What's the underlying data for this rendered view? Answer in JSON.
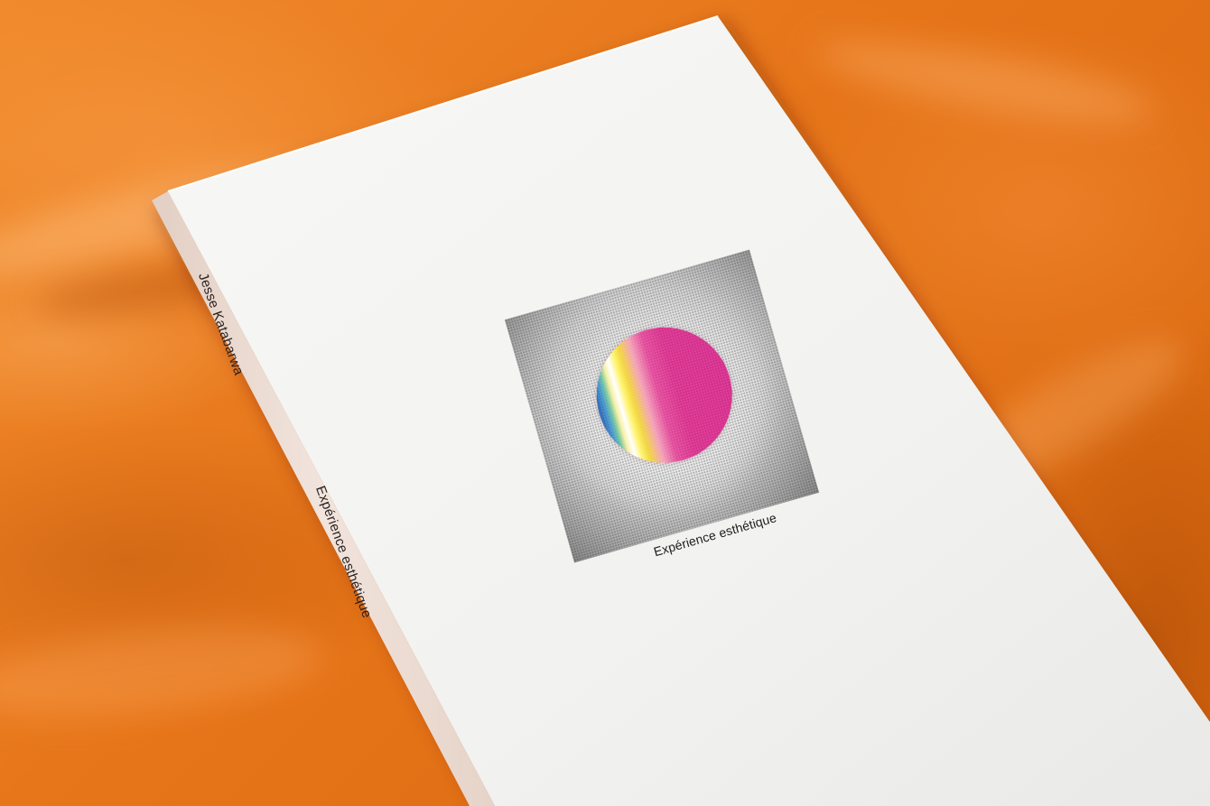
{
  "scene": {
    "background": "orange satin fabric",
    "colors": {
      "fabric": "#e8771f",
      "cover": "#f4f4f2",
      "spine": "#efe3dc",
      "orb_magenta": "#d52c8c"
    }
  },
  "book": {
    "cover_title": "Expérience esthétique",
    "spine_author": "Jesse Katabarwa",
    "spine_title": "Expérience esthétique"
  }
}
